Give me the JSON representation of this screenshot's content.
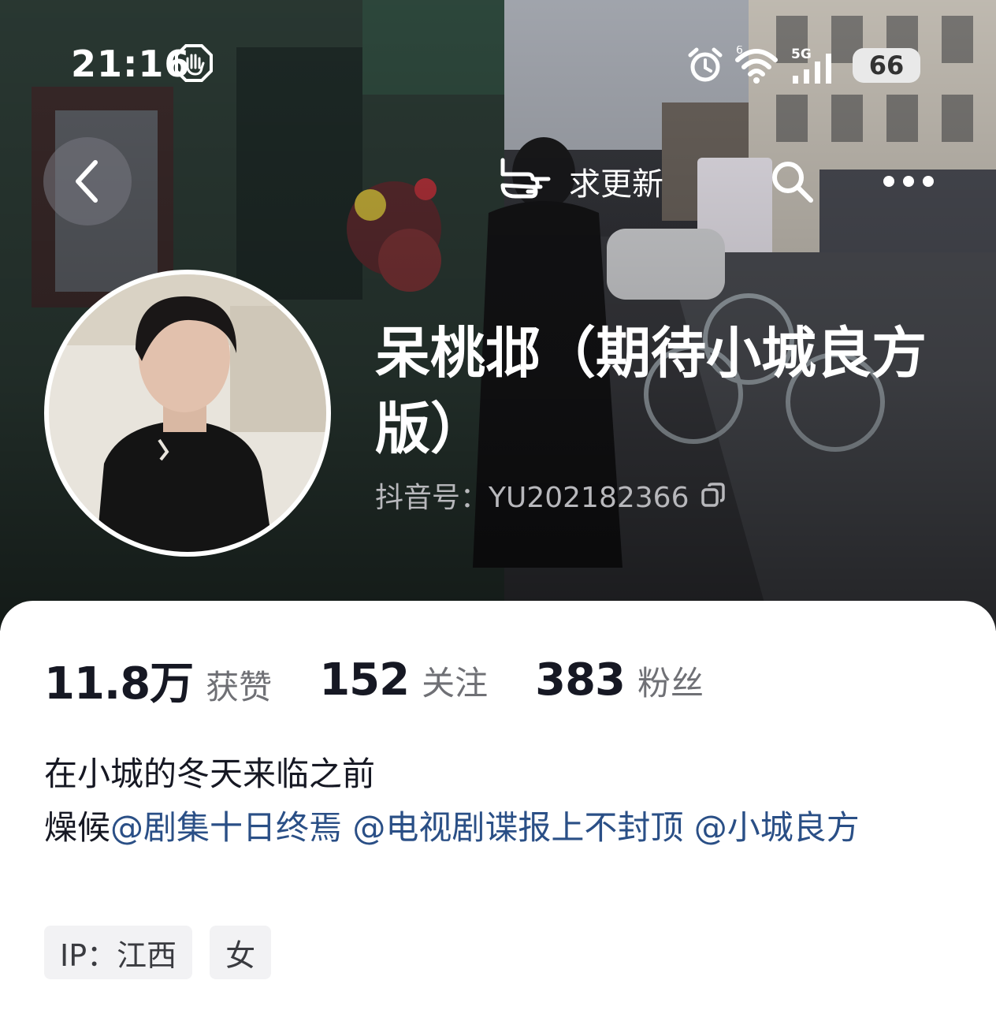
{
  "status_bar": {
    "time": "21:16",
    "icons": [
      "hand-icon",
      "alarm-icon",
      "wifi-icon",
      "signal-icon"
    ],
    "network": "5G",
    "wifi_badge": "6",
    "battery": "66"
  },
  "nav": {
    "back_icon": "chevron-left-icon",
    "update_label": "求更新",
    "update_icon": "pointing-hand-icon",
    "search_icon": "search-icon",
    "more_icon": "more-icon"
  },
  "profile": {
    "nickname": "呆桃邶（期待小城良方版）",
    "douyin_id": "抖音号：YU202182366"
  },
  "stats": [
    {
      "value": "11.8万",
      "label": "获赞"
    },
    {
      "value": "152",
      "label": "关注"
    },
    {
      "value": "383",
      "label": "粉丝"
    }
  ],
  "bio": {
    "line1": "在小城的冬天来临之前",
    "prefix": "燥候",
    "mentions": [
      "@剧集十日终焉",
      "@电视剧谍报上不封顶",
      "@小城良方"
    ]
  },
  "tags": [
    "IP：江西",
    "女"
  ],
  "colors": {
    "mention": "#2a4f86",
    "primary_text": "#161823",
    "secondary_text": "#6f7075",
    "tag_bg": "#f2f2f4"
  }
}
